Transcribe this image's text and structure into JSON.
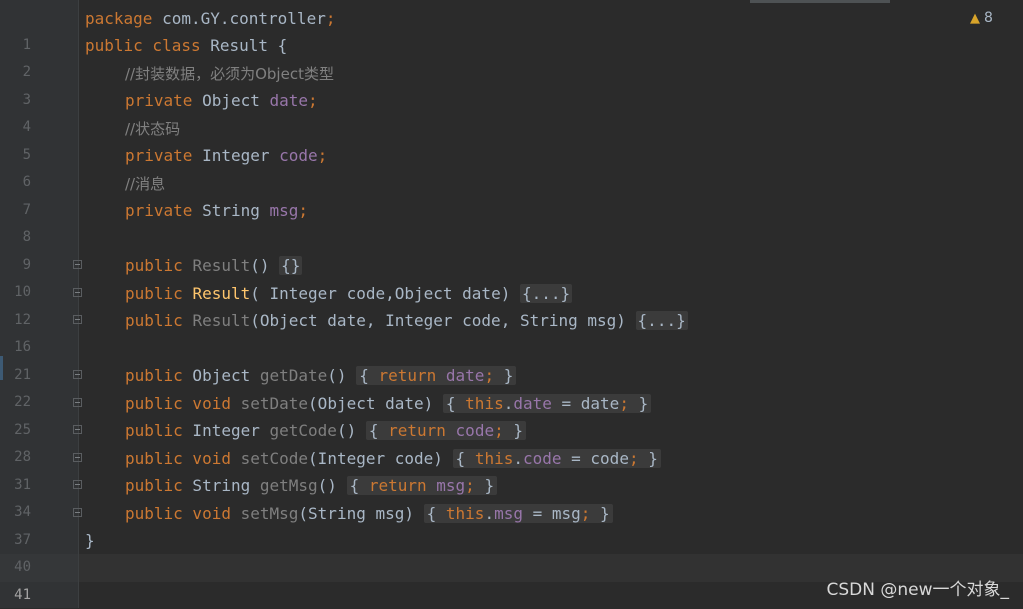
{
  "editor": {
    "warnings": {
      "icon": "warning-triangle-icon",
      "count": "8"
    },
    "watermark": "CSDN @new一个对象_",
    "lines": [
      {
        "n": "1"
      },
      {
        "n": "2"
      },
      {
        "n": "3"
      },
      {
        "n": "4"
      },
      {
        "n": "5"
      },
      {
        "n": "6"
      },
      {
        "n": "7"
      },
      {
        "n": "8"
      },
      {
        "n": "9"
      },
      {
        "n": "10"
      },
      {
        "n": "12"
      },
      {
        "n": "16"
      },
      {
        "n": "21"
      },
      {
        "n": "22"
      },
      {
        "n": "25"
      },
      {
        "n": "28"
      },
      {
        "n": "31"
      },
      {
        "n": "34"
      },
      {
        "n": "37"
      },
      {
        "n": "40"
      },
      {
        "n": "41"
      }
    ],
    "code": {
      "l1_kw": "package",
      "l1_rest": " com.GY.controller",
      "l2_kw": "public class",
      "l2_rest": " Result {",
      "l3": "//封装数据，必须为Object类型",
      "l4_kw": "private",
      "l4_type": " Object ",
      "l4_field": "date",
      "l5": "//状态码",
      "l6_kw": "private",
      "l6_type": " Integer ",
      "l6_field": "code",
      "l7": "//消息",
      "l8_kw": "private",
      "l8_type": " String ",
      "l8_field": "msg",
      "l10_kw": "public",
      "l10_name": "Result",
      "l10_rest": "() ",
      "l10_fold": "{}",
      "l12_kw": "public",
      "l12_name": "Result",
      "l12_rest": "( Integer code,",
      "l12_rest2": "Object date) ",
      "l12_fold": "{...}",
      "l16_kw": "public",
      "l16_name": "Result",
      "l16_rest": "(Object date, Integer code, String msg) ",
      "l16_fold": "{...}",
      "l22_kw": "public",
      "l22_type": " Object ",
      "l22_name": "getDate",
      "l22_rest": "() ",
      "l22_ret": "return",
      "l22_field": "date",
      "l25_kw": "public void",
      "l25_name": "setDate",
      "l25_rest": "(Object date) ",
      "l25_this": "this",
      "l25_field": "date",
      "l25_assign": " = date",
      "l28_kw": "public",
      "l28_type": " Integer ",
      "l28_name": "getCode",
      "l28_rest": "() ",
      "l28_ret": "return",
      "l28_field": "code",
      "l31_kw": "public void",
      "l31_name": "setCode",
      "l31_rest": "(Integer code) ",
      "l31_this": "this",
      "l31_field": "code",
      "l31_assign": " = code",
      "l34_kw": "public",
      "l34_type": " String ",
      "l34_name": "getMsg",
      "l34_rest": "() ",
      "l34_ret": "return",
      "l34_field": "msg",
      "l37_kw": "public void",
      "l37_name": "setMsg",
      "l37_rest": "(String msg) ",
      "l37_this": "this",
      "l37_field": "msg",
      "l37_assign": " = msg",
      "l40": "}"
    }
  }
}
